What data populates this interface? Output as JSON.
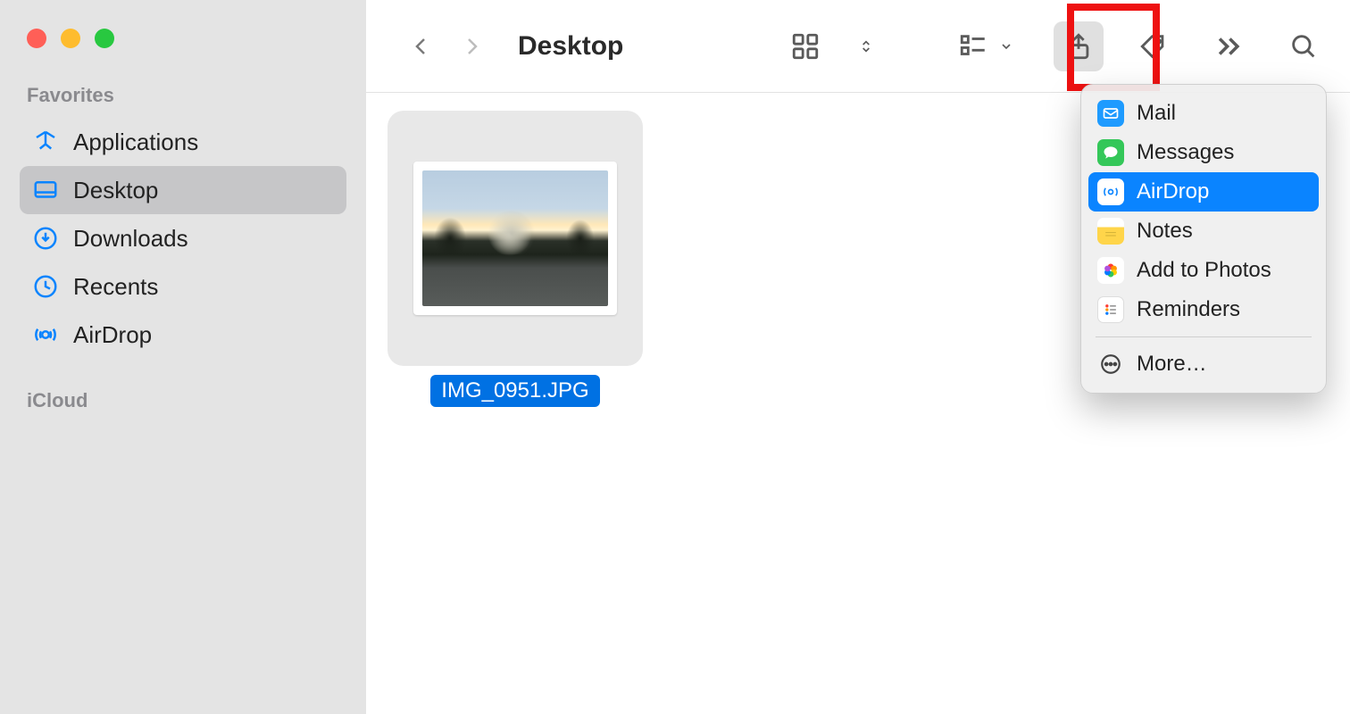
{
  "sidebar": {
    "sections": {
      "favorites_label": "Favorites",
      "icloud_label": "iCloud"
    },
    "items": [
      {
        "label": "Applications",
        "icon": "applications"
      },
      {
        "label": "Desktop",
        "icon": "desktop",
        "selected": true
      },
      {
        "label": "Downloads",
        "icon": "downloads"
      },
      {
        "label": "Recents",
        "icon": "recents"
      },
      {
        "label": "AirDrop",
        "icon": "airdrop"
      }
    ]
  },
  "toolbar": {
    "title": "Desktop"
  },
  "content": {
    "files": [
      {
        "name": "IMG_0951.JPG",
        "selected": true
      }
    ]
  },
  "share_menu": {
    "items": [
      {
        "label": "Mail",
        "icon": "mail",
        "bg": "#1e9bff"
      },
      {
        "label": "Messages",
        "icon": "messages",
        "bg": "#34c759"
      },
      {
        "label": "AirDrop",
        "icon": "airdrop",
        "bg": "#ffffff",
        "highlighted": true
      },
      {
        "label": "Notes",
        "icon": "notes",
        "bg": "#ffd54a"
      },
      {
        "label": "Add to Photos",
        "icon": "photos",
        "bg": "#ffffff"
      },
      {
        "label": "Reminders",
        "icon": "reminders",
        "bg": "#ffffff"
      }
    ],
    "more_label": "More…"
  }
}
